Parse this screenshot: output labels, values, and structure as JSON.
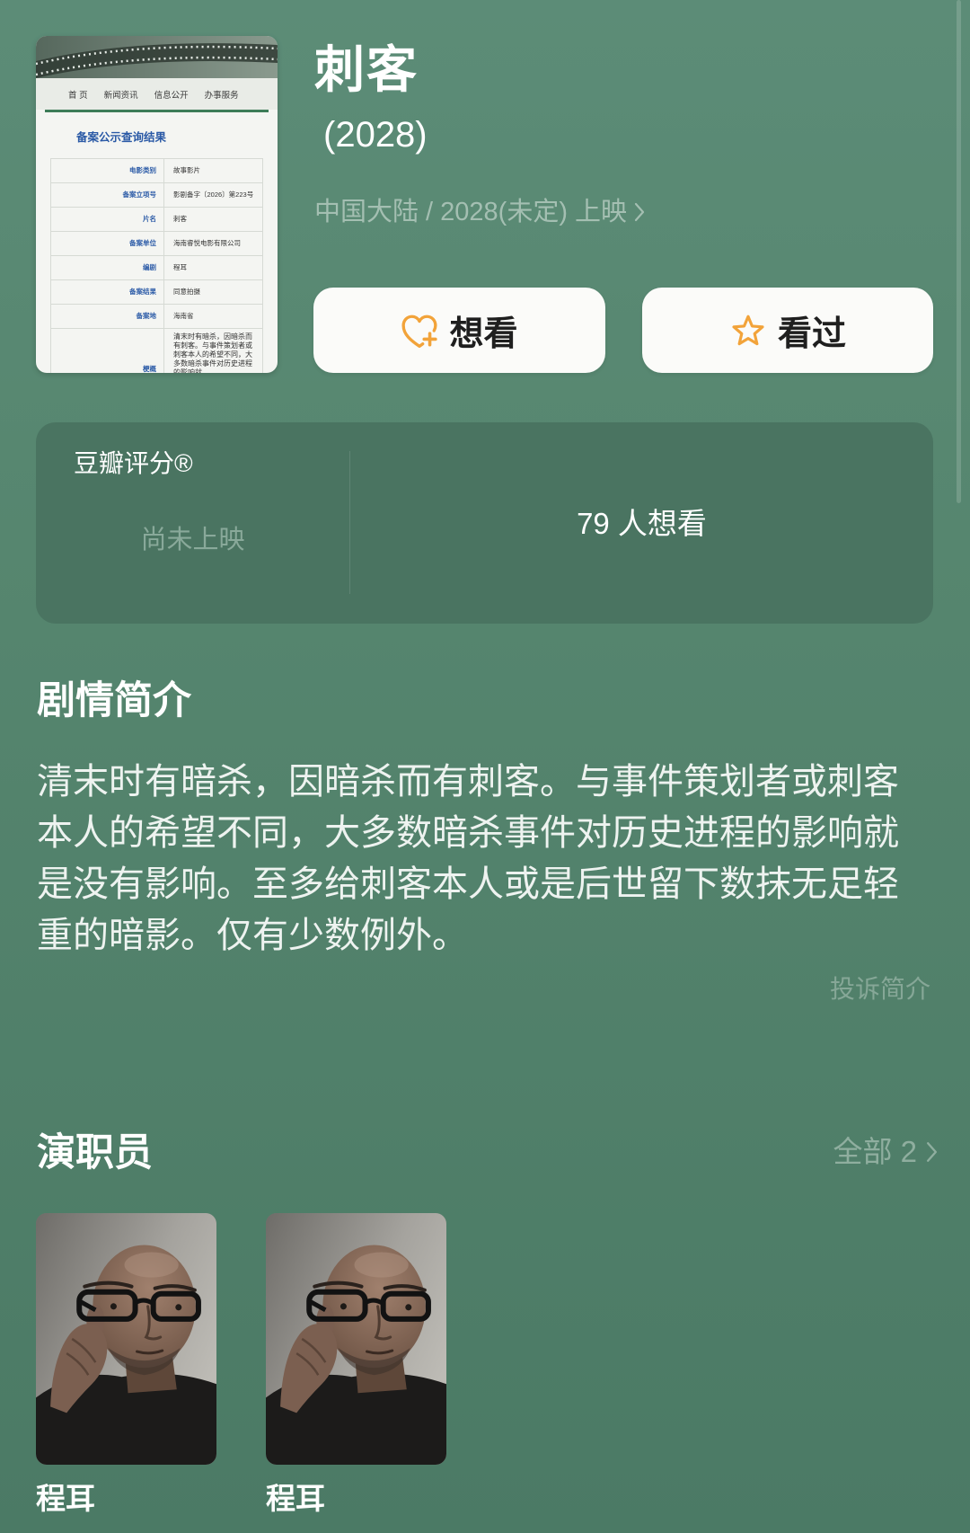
{
  "poster": {
    "nav": [
      "首 页",
      "新闻资讯",
      "信息公开",
      "办事服务"
    ],
    "heading": "备案公示查询结果",
    "rows": [
      {
        "label": "电影类别",
        "value": "故事影片"
      },
      {
        "label": "备案立项号",
        "value": "影剧备字〔2026〕第223号"
      },
      {
        "label": "片名",
        "value": "刺客"
      },
      {
        "label": "备案单位",
        "value": "海南睿悦电影有限公司"
      },
      {
        "label": "编剧",
        "value": "程耳"
      },
      {
        "label": "备案结果",
        "value": "同意拍摄"
      },
      {
        "label": "备案地",
        "value": "海南省"
      },
      {
        "label": "梗概",
        "value": "清末时有暗杀，因暗杀而有刺客。与事件策划者或刺客本人的希望不同，大多数暗杀事件对历史进程的影响就"
      }
    ]
  },
  "movie": {
    "title": "刺客",
    "year": "(2028)",
    "release_info": "中国大陆 / 2028(未定) 上映"
  },
  "actions": {
    "want_label": "想看",
    "watched_label": "看过"
  },
  "rating": {
    "label": "豆瓣评分®",
    "status": "尚未上映",
    "wish_count": "79 人想看"
  },
  "synopsis": {
    "heading": "剧情简介",
    "text": "清末时有暗杀，因暗杀而有刺客。与事件策划者或刺客本人的希望不同，大多数暗杀事件对历史进程的影响就是没有影响。至多给刺客本人或是后世留下数抹无足轻重的暗影。仅有少数例外。",
    "report_label": "投诉简介"
  },
  "cast": {
    "heading": "演职员",
    "all_label": "全部 2",
    "members": [
      {
        "name": "程耳"
      },
      {
        "name": "程耳"
      }
    ]
  },
  "icons": {
    "want": "heart-plus-icon",
    "watched": "star-icon",
    "more": "chevron-right-icon"
  },
  "colors": {
    "background_top": "#5c8c77",
    "background_bottom": "#4b7a65",
    "card": "#4a7461",
    "accent": "#f2a33a",
    "button_bg": "#fbfbf9",
    "muted_text": "#a4bfb2",
    "dim_text": "#86a797",
    "link_text": "#8fae9f"
  }
}
